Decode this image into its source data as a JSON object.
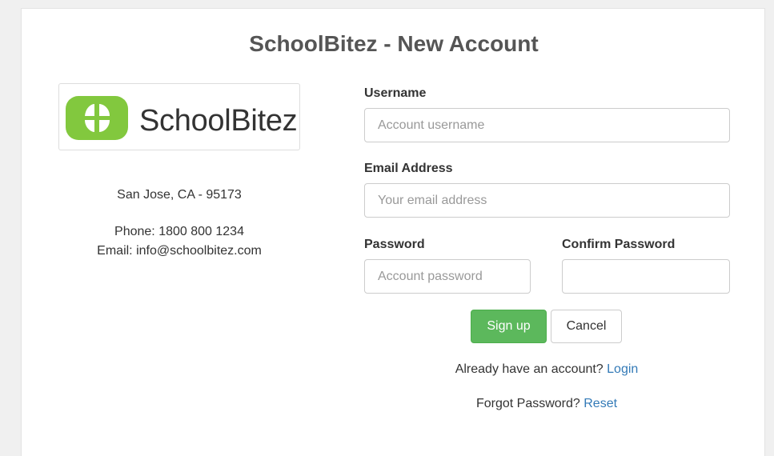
{
  "page": {
    "title": "SchoolBitez - New Account"
  },
  "brand": {
    "logo_icon": "schoolbitez-logo-icon",
    "logo_text": "SchoolBitez",
    "logo_color": "#82c83e",
    "address": "San Jose, CA - 95173",
    "phone": "Phone: 1800 800 1234",
    "email": "Email: info@schoolbitez.com"
  },
  "form": {
    "username": {
      "label": "Username",
      "placeholder": "Account username",
      "value": ""
    },
    "email": {
      "label": "Email Address",
      "placeholder": "Your email address",
      "value": ""
    },
    "password": {
      "label": "Password",
      "placeholder": "Account password",
      "value": ""
    },
    "confirm_password": {
      "label": "Confirm Password",
      "placeholder": "",
      "value": ""
    },
    "signup_label": "Sign up",
    "cancel_label": "Cancel"
  },
  "links": {
    "login_prompt": "Already have an account? ",
    "login_label": "Login",
    "forgot_prompt": "Forgot Password? ",
    "reset_label": "Reset"
  },
  "colors": {
    "primary": "#5cb85c",
    "link": "#337ab7"
  }
}
